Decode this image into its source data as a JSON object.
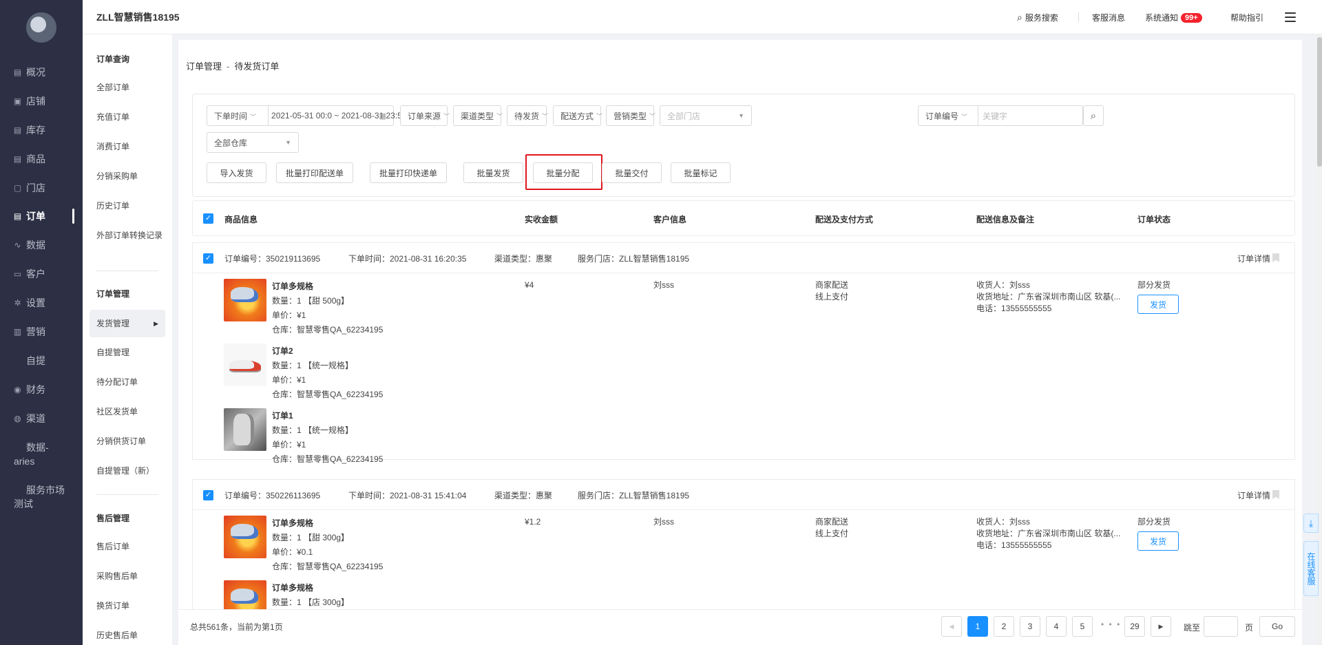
{
  "header": {
    "brand": "ZLL智慧销售18195",
    "search": "服务搜索",
    "service_msg": "客服消息",
    "notice": "系统通知",
    "notice_badge": "99+",
    "help": "帮助指引"
  },
  "nav": {
    "items": [
      {
        "label": "概况",
        "icon": "chart-icon"
      },
      {
        "label": "店铺",
        "icon": "store-icon"
      },
      {
        "label": "库存",
        "icon": "inventory-icon"
      },
      {
        "label": "商品",
        "icon": "goods-icon"
      },
      {
        "label": "门店",
        "icon": "shop-icon"
      },
      {
        "label": "订单",
        "icon": "order-icon"
      },
      {
        "label": "数据",
        "icon": "data-icon"
      },
      {
        "label": "客户",
        "icon": "customer-icon"
      },
      {
        "label": "设置",
        "icon": "gear-icon"
      },
      {
        "label": "营销",
        "icon": "marketing-icon"
      },
      {
        "label": "自提",
        "icon": ""
      },
      {
        "label": "财务",
        "icon": "finance-icon"
      },
      {
        "label": "渠道",
        "icon": "channel-icon"
      }
    ],
    "extra_1": "数据-\naries",
    "extra_2": "服务市场\n测试"
  },
  "submenu": {
    "group1": "订单查询",
    "group1_items": [
      "全部订单",
      "充值订单",
      "消费订单",
      "分销采购单",
      "历史订单",
      "外部订单转换记录"
    ],
    "group2": "订单管理",
    "group2_items": [
      "发货管理",
      "自提管理",
      "待分配订单",
      "社区发货单",
      "分销供货订单",
      "自提管理（新）"
    ],
    "group3": "售后管理",
    "group3_items": [
      "售后订单",
      "采购售后单",
      "换货订单",
      "历史售后单"
    ]
  },
  "breadcrumb": {
    "parent": "订单管理",
    "current": "待发货订单"
  },
  "filters": {
    "time_type": "下单时间",
    "date_range": "2021-05-31 00:0 ~ 2021-08-31 23:5",
    "order_source": "订单来源",
    "channel_type": "渠道类型",
    "status": "待发货",
    "delivery": "配送方式",
    "marketing": "营销类型",
    "store_placeholder": "全部门店",
    "search_type": "订单编号",
    "keyword_placeholder": "关键字",
    "warehouse": "全部仓库"
  },
  "actions": [
    "导入发货",
    "批量打印配送单",
    "批量打印快递单",
    "批量发货",
    "批量分配",
    "批量交付",
    "批量标记"
  ],
  "table_headers": [
    "商品信息",
    "实收金额",
    "客户信息",
    "配送及支付方式",
    "配送信息及备注",
    "订单状态"
  ],
  "orders": [
    {
      "order_no": "订单编号：350219113695",
      "order_time": "下单时间：2021-08-31 16:20:35",
      "channel": "渠道类型：惠聚",
      "store": "服务门店：ZLL智慧销售18195",
      "detail": "订单详情",
      "amount": "¥4",
      "customer": "刘sss",
      "delivery": "商家配送",
      "payment": "线上支付",
      "receiver": "收货人：刘sss",
      "address": "收货地址：广东省深圳市南山区 软基(...",
      "phone": "电话：13555555555",
      "status": "部分发货",
      "ship_btn": "发货",
      "products": [
        {
          "name": "订单多规格",
          "qty": "数量：1 【甜 500g】",
          "price": "单价：¥1",
          "warehouse": "仓库：智慧零售QA_62234195"
        },
        {
          "name": "订单2",
          "qty": "数量：1 【统一规格】",
          "price": "单价：¥1",
          "warehouse": "仓库：智慧零售QA_62234195"
        },
        {
          "name": "订单1",
          "qty": "数量：1 【统一规格】",
          "price": "单价：¥1",
          "warehouse": "仓库：智慧零售QA_62234195"
        }
      ]
    },
    {
      "order_no": "订单编号：350226113695",
      "order_time": "下单时间：2021-08-31 15:41:04",
      "channel": "渠道类型：惠聚",
      "store": "服务门店：ZLL智慧销售18195",
      "detail": "订单详情",
      "amount": "¥1.2",
      "customer": "刘sss",
      "delivery": "商家配送",
      "payment": "线上支付",
      "receiver": "收货人：刘sss",
      "address": "收货地址：广东省深圳市南山区 软基(...",
      "phone": "电话：13555555555",
      "status": "部分发货",
      "ship_btn": "发货",
      "products": [
        {
          "name": "订单多规格",
          "qty": "数量：1 【甜 300g】",
          "price": "单价：¥0.1",
          "warehouse": "仓库：智慧零售QA_62234195"
        },
        {
          "name": "订单多规格",
          "qty": "数量：1 【店 300g】",
          "price": "",
          "warehouse": ""
        }
      ]
    }
  ],
  "pagination": {
    "total": "总共561条，当前为第1页",
    "pages": [
      "1",
      "2",
      "3",
      "4",
      "5"
    ],
    "dots": "• • •",
    "last": "29",
    "jump_label": "跳至",
    "page_label": "页",
    "go": "Go"
  },
  "float": {
    "customer_service": "在线客服"
  }
}
